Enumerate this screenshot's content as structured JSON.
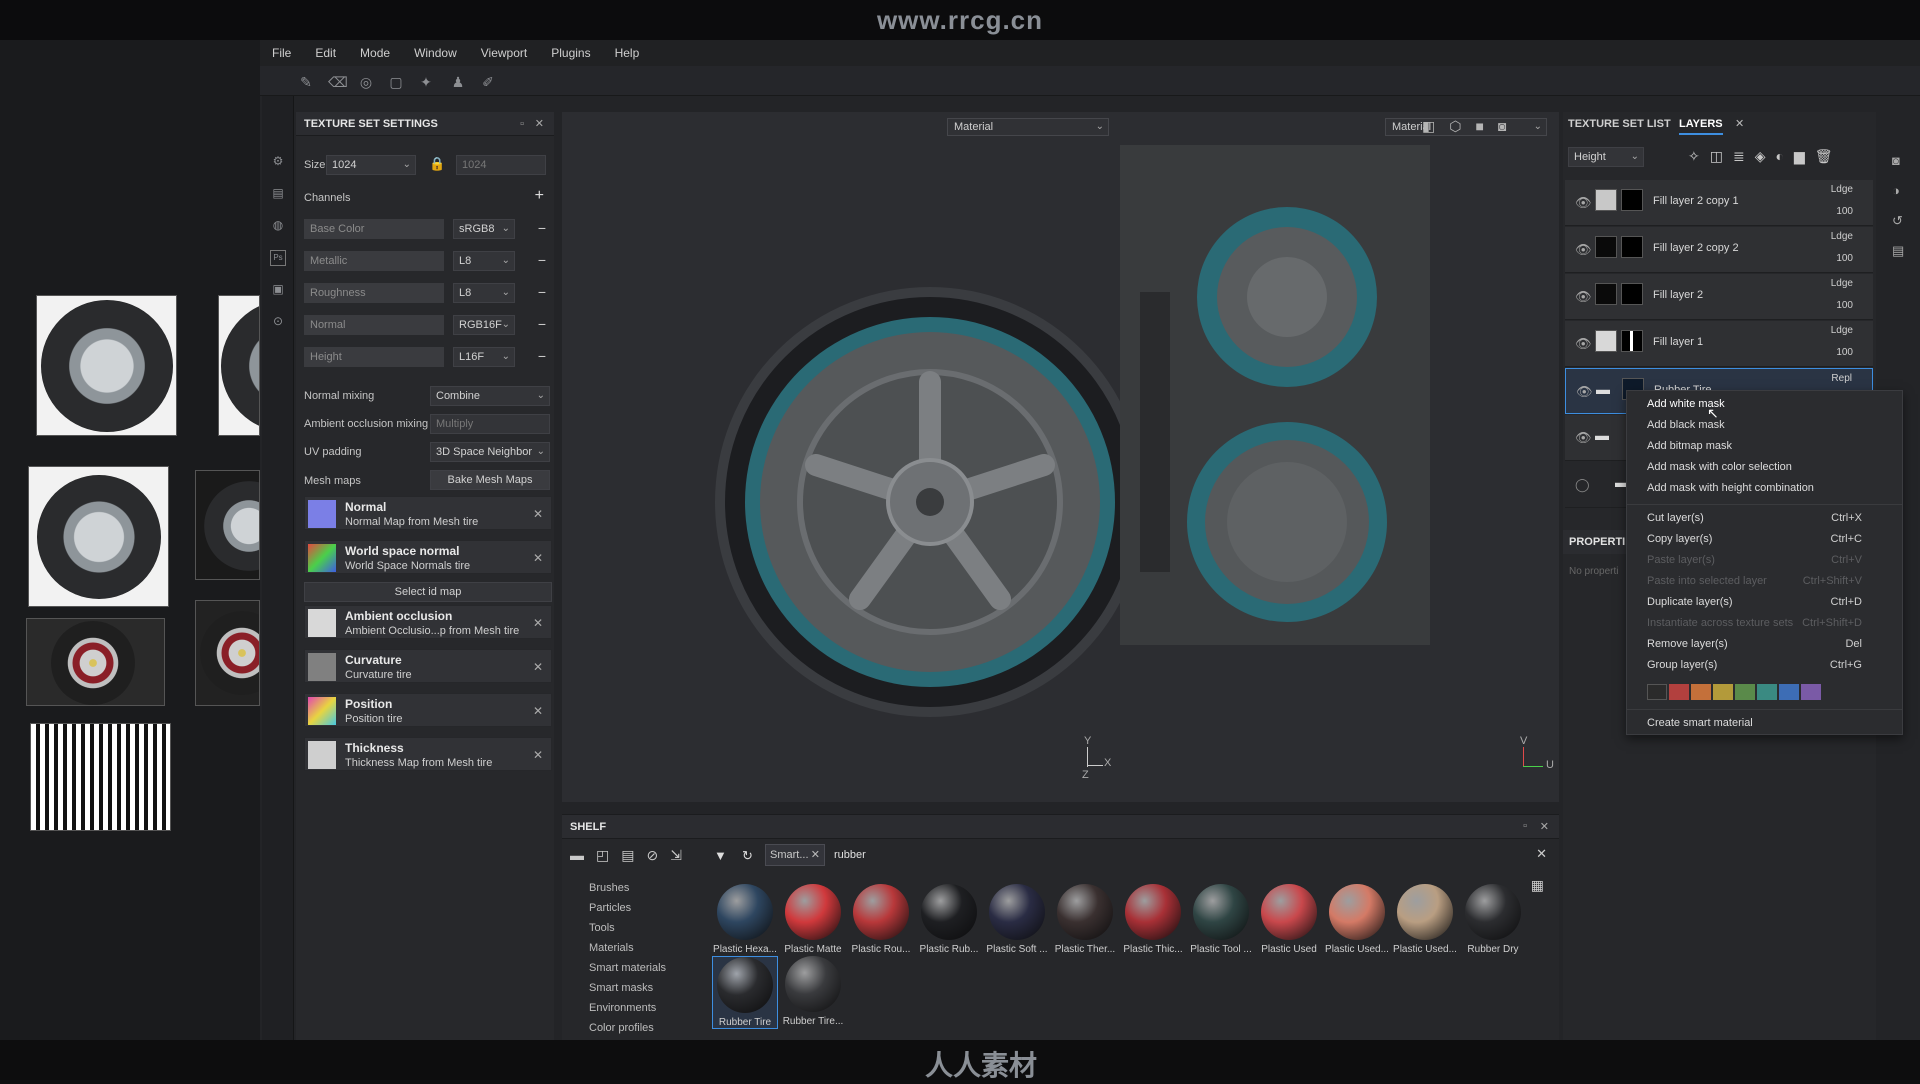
{
  "watermark_url": "www.rrcg.cn",
  "bottom_watermark": "人人素材",
  "menu": [
    "File",
    "Edit",
    "Mode",
    "Window",
    "Viewport",
    "Plugins",
    "Help"
  ],
  "texture_set_settings": {
    "title": "TEXTURE SET SETTINGS",
    "size_label": "Size",
    "size_value": "1024",
    "size_locked_value": "1024",
    "channels_label": "Channels",
    "channels": [
      {
        "name": "Base Color",
        "format": "sRGB8"
      },
      {
        "name": "Metallic",
        "format": "L8"
      },
      {
        "name": "Roughness",
        "format": "L8"
      },
      {
        "name": "Normal",
        "format": "RGB16F"
      },
      {
        "name": "Height",
        "format": "L16F"
      }
    ],
    "normal_mixing_label": "Normal mixing",
    "normal_mixing_value": "Combine",
    "ao_mixing_label": "Ambient occlusion mixing",
    "ao_mixing_value": "Multiply",
    "uv_padding_label": "UV padding",
    "uv_padding_value": "3D Space Neighbor",
    "mesh_maps_label": "Mesh maps",
    "bake_button": "Bake Mesh Maps",
    "select_id_map": "Select id map",
    "mesh_maps": [
      {
        "title": "Normal",
        "sub": "Normal Map from Mesh tire"
      },
      {
        "title": "World space normal",
        "sub": "World Space Normals tire"
      },
      {
        "title": "Ambient occlusion",
        "sub": "Ambient Occlusio...p from Mesh tire"
      },
      {
        "title": "Curvature",
        "sub": "Curvature tire"
      },
      {
        "title": "Position",
        "sub": "Position tire"
      },
      {
        "title": "Thickness",
        "sub": "Thickness Map from Mesh tire"
      }
    ]
  },
  "viewport": {
    "left_dropdown": "Material",
    "right_dropdown": "Material",
    "axis_3d": {
      "y": "Y",
      "x": "X",
      "z": "Z"
    },
    "axis_uv": {
      "v": "V",
      "u": "U"
    }
  },
  "layers_panel": {
    "tab_texture_set_list": "TEXTURE SET LIST",
    "tab_layers": "LAYERS",
    "channel_dropdown": "Height",
    "layers": [
      {
        "name": "Fill layer 2 copy 1",
        "blend": "Ldge",
        "opacity": "100"
      },
      {
        "name": "Fill layer 2 copy 2",
        "blend": "Ldge",
        "opacity": "100"
      },
      {
        "name": "Fill layer 2",
        "blend": "Ldge",
        "opacity": "100"
      },
      {
        "name": "Fill layer 1",
        "blend": "Ldge",
        "opacity": "100"
      },
      {
        "name": "Rubber Tire",
        "blend": "Repl",
        "opacity": ""
      }
    ],
    "properties_label": "PROPERTI",
    "no_properties": "No properti"
  },
  "context_menu": {
    "items": [
      {
        "label": "Add white mask",
        "shortcut": "",
        "disabled": false
      },
      {
        "label": "Add black mask",
        "shortcut": "",
        "disabled": false
      },
      {
        "label": "Add bitmap mask",
        "shortcut": "",
        "disabled": false
      },
      {
        "label": "Add mask with color selection",
        "shortcut": "",
        "disabled": false
      },
      {
        "label": "Add mask with height combination",
        "shortcut": "",
        "disabled": false
      },
      {
        "label": "Cut layer(s)",
        "shortcut": "Ctrl+X",
        "disabled": false
      },
      {
        "label": "Copy layer(s)",
        "shortcut": "Ctrl+C",
        "disabled": false
      },
      {
        "label": "Paste layer(s)",
        "shortcut": "Ctrl+V",
        "disabled": true
      },
      {
        "label": "Paste into selected layer",
        "shortcut": "Ctrl+Shift+V",
        "disabled": true
      },
      {
        "label": "Duplicate layer(s)",
        "shortcut": "Ctrl+D",
        "disabled": false
      },
      {
        "label": "Instantiate across texture sets",
        "shortcut": "Ctrl+Shift+D",
        "disabled": true
      },
      {
        "label": "Remove layer(s)",
        "shortcut": "Del",
        "disabled": false
      },
      {
        "label": "Group layer(s)",
        "shortcut": "Ctrl+G",
        "disabled": false
      },
      {
        "label": "Create smart material",
        "shortcut": "",
        "disabled": false
      }
    ],
    "colors": [
      "#2b2b2b",
      "#b2403e",
      "#c4703a",
      "#b39a3a",
      "#5a8a4a",
      "#3a8a82",
      "#3d6db5",
      "#7a5aa6"
    ]
  },
  "shelf": {
    "title": "SHELF",
    "filter_chip": "Smart...",
    "search_value": "rubber",
    "categories": [
      "Brushes",
      "Particles",
      "Tools",
      "Materials",
      "Smart materials",
      "Smart masks",
      "Environments",
      "Color profiles"
    ],
    "materials": [
      {
        "label": "Plastic Hexa...",
        "color": "#2e4660"
      },
      {
        "label": "Plastic Matte",
        "color": "#d0393c"
      },
      {
        "label": "Plastic Rou...",
        "color": "#b8383a"
      },
      {
        "label": "Plastic Rub...",
        "color": "#1e1f22"
      },
      {
        "label": "Plastic Soft ...",
        "color": "#2a2c44"
      },
      {
        "label": "Plastic Ther...",
        "color": "#3a3030"
      },
      {
        "label": "Plastic Thic...",
        "color": "#a83036"
      },
      {
        "label": "Plastic Tool ...",
        "color": "#2f4544"
      },
      {
        "label": "Plastic Used",
        "color": "#c9484c"
      },
      {
        "label": "Plastic Used...",
        "color": "#d47a66"
      },
      {
        "label": "Plastic Used...",
        "color": "#b99e82"
      },
      {
        "label": "Rubber Dry",
        "color": "#2c2d30"
      },
      {
        "label": "Rubber Tire",
        "color": "#2a2b2e"
      },
      {
        "label": "Rubber Tire...",
        "color": "#3a3b3e"
      }
    ]
  }
}
